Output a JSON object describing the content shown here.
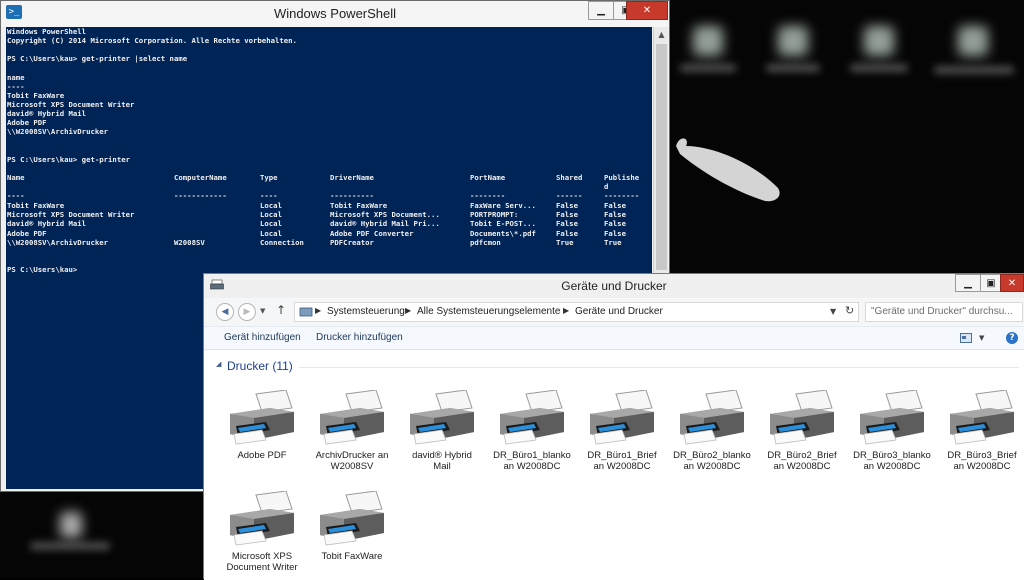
{
  "powershell": {
    "title": "Windows PowerShell",
    "header_lines": [
      "Windows PowerShell",
      "Copyright (C) 2014 Microsoft Corporation. Alle Rechte vorbehalten."
    ],
    "command1": "PS C:\\Users\\kau> get-printer |select name",
    "name_header": "name",
    "name_rule": "----",
    "names": [
      "Tobit FaxWare",
      "Microsoft XPS Document Writer",
      "david® Hybrid Mail",
      "Adobe PDF",
      "\\\\W2008SV\\ArchivDrucker"
    ],
    "command2": "PS C:\\Users\\kau> get-printer",
    "table": {
      "headers": [
        "Name",
        "ComputerName",
        "Type",
        "DriverName",
        "PortName",
        "Shared",
        "Publishe\nd"
      ],
      "rules": [
        "----",
        "------------",
        "----",
        "----------",
        "--------",
        "------",
        "--------"
      ],
      "rows": [
        [
          "Tobit FaxWare",
          "",
          "Local",
          "Tobit FaxWare",
          "FaxWare Serv...",
          "False",
          "False"
        ],
        [
          "Microsoft XPS Document Writer",
          "",
          "Local",
          "Microsoft XPS Document...",
          "PORTPROMPT:",
          "False",
          "False"
        ],
        [
          "david® Hybrid Mail",
          "",
          "Local",
          "david® Hybrid Mail Pri...",
          "Tobit E-POST...",
          "False",
          "False"
        ],
        [
          "Adobe PDF",
          "",
          "Local",
          "Adobe PDF Converter",
          "Documents\\*.pdf",
          "False",
          "False"
        ],
        [
          "\\\\W2008SV\\ArchivDrucker",
          "W2008SV",
          "Connection",
          "PDFCreator",
          "pdfcmon",
          "True",
          "True"
        ]
      ]
    },
    "prompt": "PS C:\\Users\\kau>",
    "console_bg": "#012456"
  },
  "explorer": {
    "title": "Geräte und Drucker",
    "breadcrumb": [
      "Systemsteuerung",
      "Alle Systemsteuerungselemente",
      "Geräte und Drucker"
    ],
    "search_placeholder": "\"Geräte und Drucker\" durchsu...",
    "toolbar": {
      "add_device": "Gerät hinzufügen",
      "add_printer": "Drucker hinzufügen"
    },
    "group_header": "Drucker (11)",
    "printers": [
      "Adobe PDF",
      "ArchivDrucker an\nW2008SV",
      "david® Hybrid\nMail",
      "DR_Büro1_blanko\nan W2008DC",
      "DR_Büro1_Brief\nan W2008DC",
      "DR_Büro2_blanko\nan W2008DC",
      "DR_Büro2_Brief\nan W2008DC",
      "DR_Büro3_blanko\nan W2008DC",
      "DR_Büro3_Brief\nan W2008DC",
      "Microsoft XPS\nDocument Writer",
      "Tobit FaxWare"
    ]
  }
}
